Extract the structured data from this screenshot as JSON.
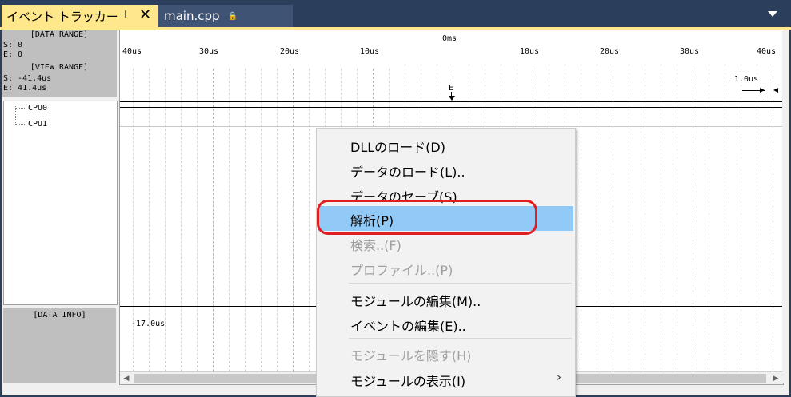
{
  "tabs": [
    {
      "label": "イベント トラッカー",
      "active": true,
      "pin_icon": "pin-icon",
      "close_glyph": "✕"
    },
    {
      "label": "main.cpp",
      "active": false,
      "lock_icon": "lock-icon"
    }
  ],
  "info_panel": {
    "data_range_title": "[DATA RANGE]",
    "data_range_start": "S: 0",
    "data_range_end": "E: 0",
    "view_range_title": "[VIEW RANGE]",
    "view_range_start": "S: -41.4us",
    "view_range_end": "E: 41.4us"
  },
  "tree": {
    "items": [
      "CPU0",
      "CPU1"
    ]
  },
  "data_info": {
    "title": "[DATA INFO]"
  },
  "timeline": {
    "center_label": "0ms",
    "ticks": [
      "40us",
      "30us",
      "20us",
      "10us",
      "10us",
      "20us",
      "30us",
      "40us"
    ],
    "scale_label": "1.0us",
    "marker_label": "E",
    "cursor_time": "-17.0us"
  },
  "context_menu": {
    "items": [
      {
        "label": "DLLのロード(D)",
        "enabled": true
      },
      {
        "label": "データのロード(L)..",
        "enabled": true
      },
      {
        "label": "データのセーブ(S)..",
        "enabled": true
      },
      {
        "label": "解析(P)",
        "enabled": true,
        "highlighted": true
      },
      {
        "label": "検索..(F)",
        "enabled": false
      },
      {
        "label": "プロファイル..(P)",
        "enabled": false
      },
      {
        "label": "モジュールの編集(M)..",
        "enabled": true
      },
      {
        "label": "イベントの編集(E)..",
        "enabled": true
      },
      {
        "label": "モジュールを隠す(H)",
        "enabled": false
      },
      {
        "label": "モジュールの表示(I)",
        "enabled": true,
        "submenu": true
      }
    ]
  },
  "colors": {
    "window_bg": "#2b3e5c",
    "active_tab": "#ffe88c",
    "menu_highlight": "#91c9f7",
    "annotation": "#e02020"
  }
}
